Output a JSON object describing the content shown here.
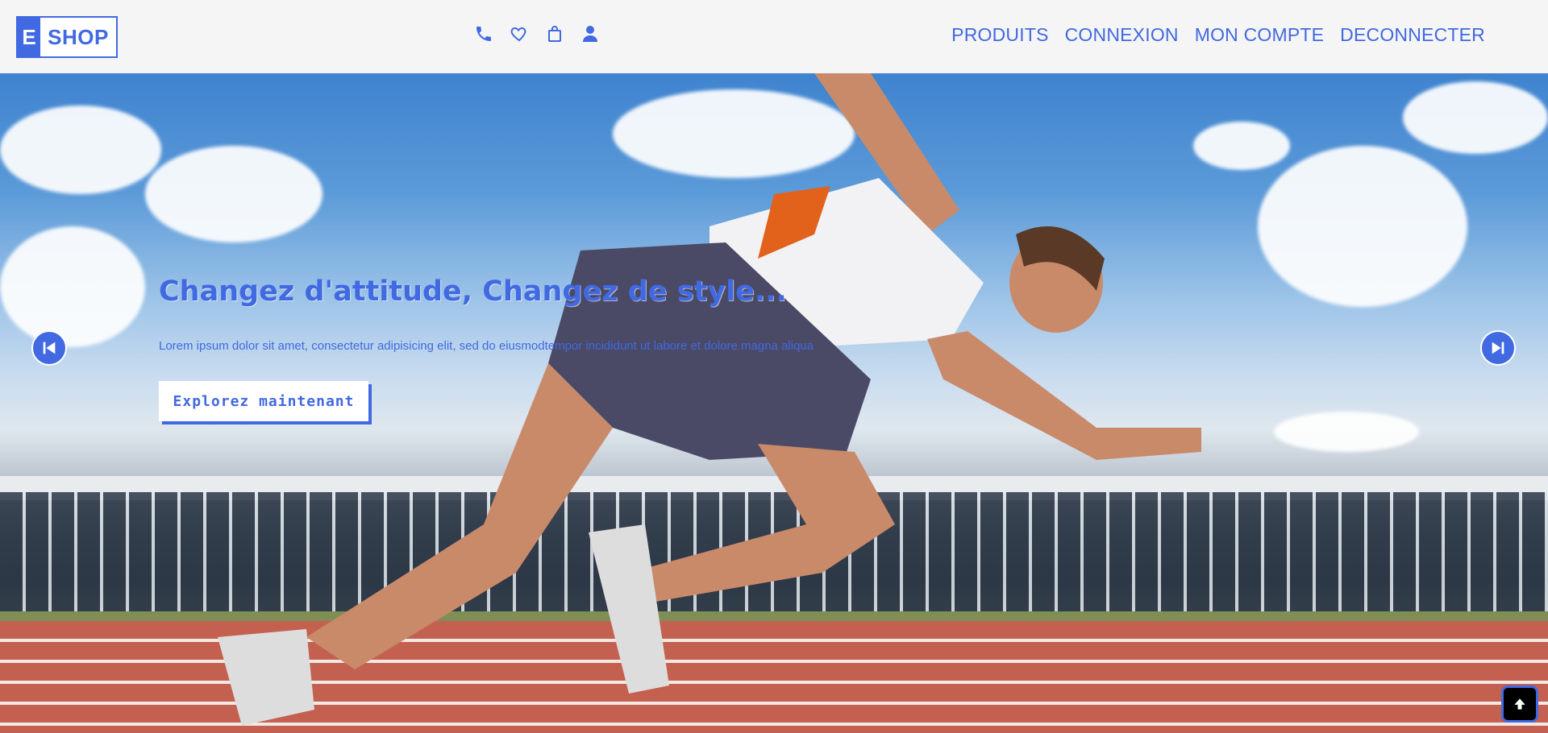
{
  "logo": {
    "e": "E",
    "shop": "SHOP"
  },
  "icons": [
    "phone-icon",
    "heart-icon",
    "shopping-bag-icon",
    "user-icon"
  ],
  "nav": {
    "produits": "PRODUITS",
    "connexion": "CONNEXION",
    "mon_compte": "MON COMPTE",
    "deconnecter": "DECONNECTER"
  },
  "hero": {
    "title": "Changez d'attitude, Changez de style...",
    "text": "Lorem ipsum dolor sit amet, consectetur adipisicing elit, sed do eiusmodtempor incididunt ut labore et dolore magna aliqua",
    "cta": "Explorez maintenant"
  },
  "colors": {
    "accent": "#4169e1",
    "header_bg": "#f5f5f5"
  }
}
